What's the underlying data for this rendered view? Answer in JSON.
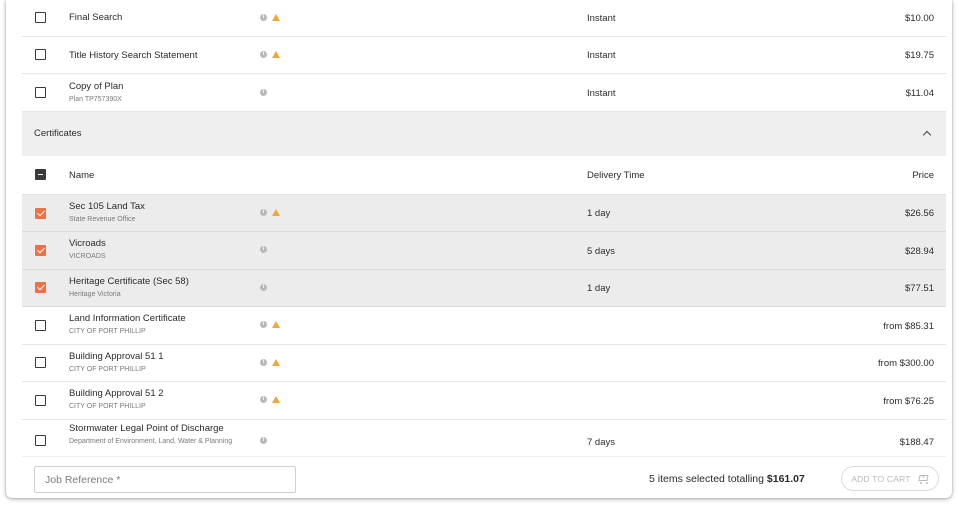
{
  "top_items": [
    {
      "name": "Final Search",
      "sub": "",
      "info": true,
      "warn": true,
      "delivery": "Instant",
      "price": "$10.00",
      "checked": false
    },
    {
      "name": "Title History Search Statement",
      "sub": "",
      "info": true,
      "warn": true,
      "delivery": "Instant",
      "price": "$19.75",
      "checked": false
    },
    {
      "name": "Copy of Plan",
      "sub": "Plan TP757390X",
      "info": true,
      "warn": false,
      "delivery": "Instant",
      "price": "$11.04",
      "checked": false
    }
  ],
  "certificates": {
    "title": "Certificates",
    "columns": {
      "name": "Name",
      "delivery": "Delivery Time",
      "price": "Price"
    },
    "items": [
      {
        "name": "Sec 105 Land Tax",
        "sub": "State Revenue Office",
        "info": true,
        "warn": true,
        "delivery": "1 day",
        "price": "$26.56",
        "checked": true
      },
      {
        "name": "Vicroads",
        "sub": "VICROADS",
        "info": true,
        "warn": false,
        "delivery": "5 days",
        "price": "$28.94",
        "checked": true
      },
      {
        "name": "Heritage Certificate (Sec 58)",
        "sub": "Heritage Victoria",
        "info": true,
        "warn": false,
        "delivery": "1 day",
        "price": "$77.51",
        "checked": true
      },
      {
        "name": "Land Information Certificate",
        "sub": "CITY OF PORT PHILLIP",
        "info": true,
        "warn": true,
        "delivery": "",
        "price": "from $85.31",
        "checked": false
      },
      {
        "name": "Building Approval 51 1",
        "sub": "CITY OF PORT PHILLIP",
        "info": true,
        "warn": true,
        "delivery": "",
        "price": "from $300.00",
        "checked": false
      },
      {
        "name": "Building Approval 51 2",
        "sub": "CITY OF PORT PHILLIP",
        "info": true,
        "warn": true,
        "delivery": "",
        "price": "from $76.25",
        "checked": false
      },
      {
        "name": "Stormwater Legal Point of Discharge",
        "sub": "Department of Environment, Land, Water & Planning",
        "info": true,
        "warn": false,
        "delivery": "7 days",
        "price": "$188.47",
        "checked": false
      }
    ]
  },
  "footer": {
    "job_reference_placeholder": "Job Reference *",
    "summary_prefix": "5 items selected totalling ",
    "summary_total": "$161.07",
    "add_to_cart_label": "ADD TO CART"
  },
  "colors": {
    "accent": "#ee7246",
    "warning": "#f2a73b",
    "info": "#b9b9b9",
    "selected_row": "#ececec"
  }
}
